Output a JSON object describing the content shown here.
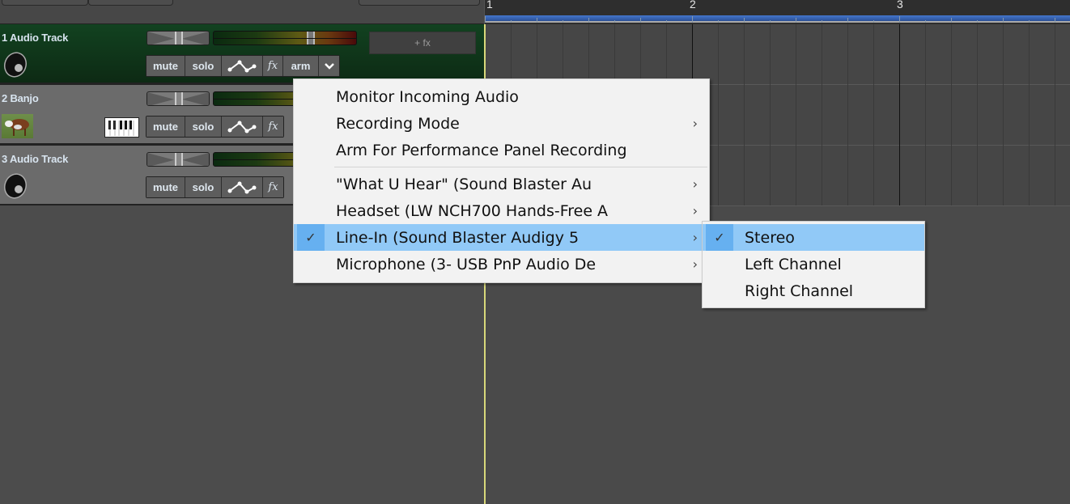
{
  "ruler": {
    "markers": [
      "1",
      "2",
      "3"
    ]
  },
  "tracks": [
    {
      "number": "1",
      "name": "1 Audio Track",
      "type": "audio",
      "selected": true,
      "icon": "speaker-icon",
      "buttons": {
        "mute": "mute",
        "solo": "solo",
        "automation": "automation-icon",
        "fx": "fx",
        "arm": "arm",
        "dropdown": "chevron-down-icon"
      },
      "fx_slot": "+ fx",
      "pan": 0.5,
      "volume": 0.7
    },
    {
      "number": "2",
      "name": "2 Banjo",
      "type": "instrument",
      "selected": false,
      "icon": "cow-thumbnail",
      "instrument_icon": "piano-keyboard-icon",
      "buttons": {
        "mute": "mute",
        "solo": "solo",
        "automation": "automation-icon",
        "fx": "fx"
      },
      "pan": 0.5
    },
    {
      "number": "3",
      "name": "3 Audio Track",
      "type": "audio",
      "selected": false,
      "icon": "speaker-icon",
      "buttons": {
        "mute": "mute",
        "solo": "solo",
        "automation": "automation-icon",
        "fx": "fx"
      },
      "pan": 0.5
    }
  ],
  "context_menu": {
    "items": [
      {
        "label": "Monitor Incoming Audio",
        "submenu": false,
        "checked": false
      },
      {
        "label": "Recording Mode",
        "submenu": true,
        "checked": false
      },
      {
        "label": "Arm For Performance Panel Recording",
        "submenu": false,
        "checked": false
      }
    ],
    "inputs": [
      {
        "label": "\"What U Hear\" (Sound Blaster Au",
        "submenu": true,
        "checked": false
      },
      {
        "label": "Headset (LW NCH700 Hands-Free A",
        "submenu": true,
        "checked": false
      },
      {
        "label": "Line-In (Sound Blaster Audigy 5",
        "submenu": true,
        "checked": true,
        "highlighted": true
      },
      {
        "label": "Microphone (3- USB PnP Audio De",
        "submenu": true,
        "checked": false
      }
    ],
    "check_glyph": "✓",
    "arrow_glyph": "›"
  },
  "channel_submenu": {
    "items": [
      {
        "label": "Stereo",
        "checked": true,
        "highlighted": true
      },
      {
        "label": "Left Channel",
        "checked": false
      },
      {
        "label": "Right Channel",
        "checked": false
      }
    ]
  },
  "colors": {
    "selected_track": "#124220",
    "menu_highlight": "#91c9f7",
    "loop_bar": "#3a66b8",
    "playhead": "#d8d87a"
  }
}
